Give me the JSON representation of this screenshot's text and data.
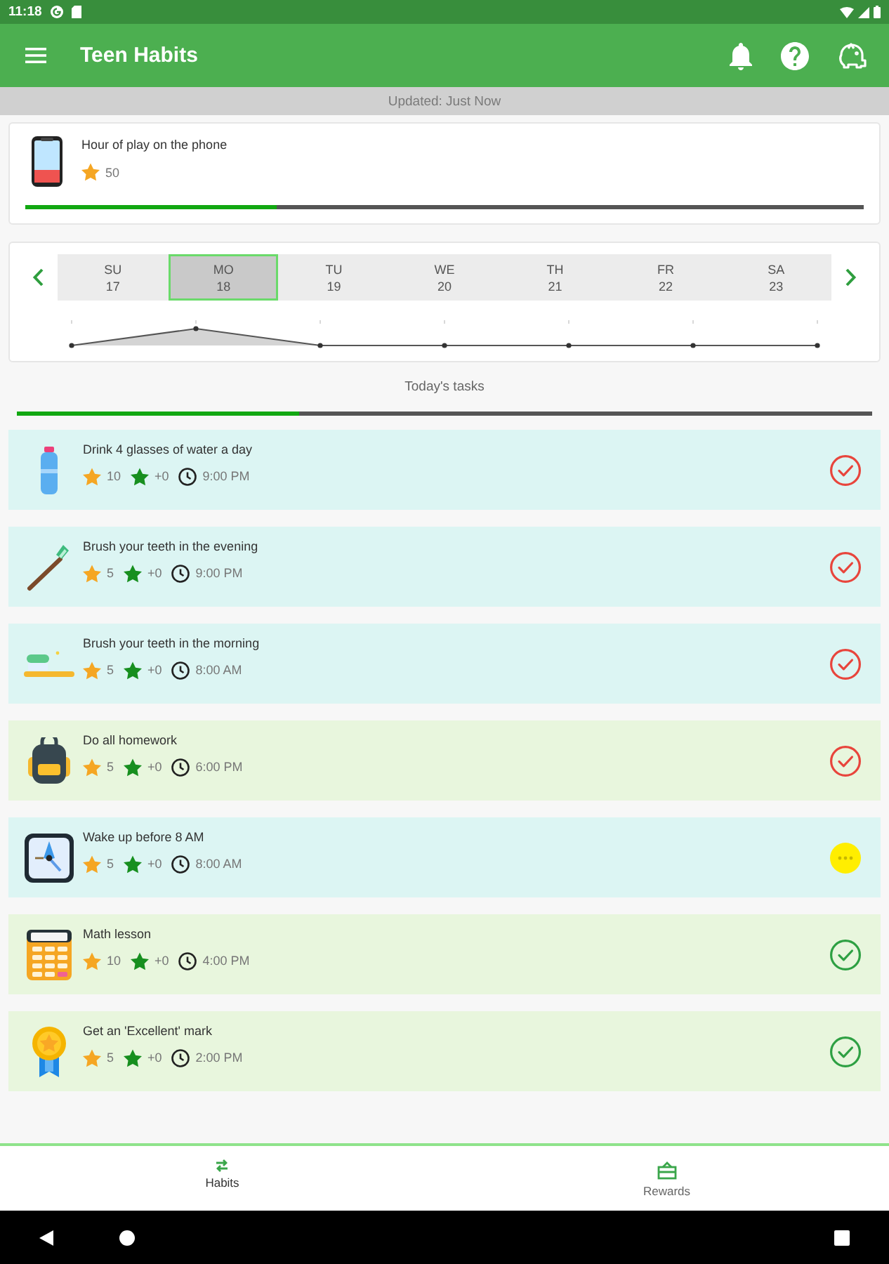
{
  "status_bar": {
    "time": "11:18"
  },
  "app_bar": {
    "title": "Teen Habits"
  },
  "update_banner": {
    "text": "Updated: Just Now"
  },
  "reward": {
    "title": "Hour of play on the phone",
    "points": "50",
    "level": 0.3
  },
  "week": {
    "days": [
      {
        "day": "SU",
        "date": "17",
        "selected": false
      },
      {
        "day": "MO",
        "date": "18",
        "selected": true
      },
      {
        "day": "TU",
        "date": "19",
        "selected": false
      },
      {
        "day": "WE",
        "date": "20",
        "selected": false
      },
      {
        "day": "TH",
        "date": "21",
        "selected": false
      },
      {
        "day": "FR",
        "date": "22",
        "selected": false
      },
      {
        "day": "SA",
        "date": "23",
        "selected": false
      }
    ]
  },
  "tasks_header": {
    "title": "Today's tasks",
    "level": 0.33
  },
  "tasks": [
    {
      "kind": "bottle",
      "title": "Drink 4 glasses of water a day",
      "points": "10",
      "bonus": "+0",
      "time": "9:00 PM",
      "color": "#dcf5f3",
      "status_icon": {
        "kind": "check",
        "color": "#e8453c"
      }
    },
    {
      "kind": "toothbrush",
      "title": "Brush your teeth in the evening",
      "points": "5",
      "bonus": "+0",
      "time": "9:00 PM",
      "color": "#dcf5f3",
      "status_icon": {
        "kind": "check",
        "color": "#e8453c"
      }
    },
    {
      "kind": "toothpaste",
      "title": "Brush your teeth in the morning",
      "points": "5",
      "bonus": "+0",
      "time": "8:00 AM",
      "color": "#dcf5f3",
      "status_icon": {
        "kind": "check",
        "color": "#e8453c"
      }
    },
    {
      "kind": "backpack",
      "title": "Do all homework",
      "points": "5",
      "bonus": "+0",
      "time": "6:00 PM",
      "color": "#e8f6dd",
      "status_icon": {
        "kind": "check",
        "color": "#e8453c"
      }
    },
    {
      "kind": "clock",
      "title": "Wake up before 8 AM",
      "points": "5",
      "bonus": "+0",
      "time": "8:00 AM",
      "color": "#dcf5f3",
      "status_icon": {
        "kind": "dots",
        "color": "#ffee00"
      }
    },
    {
      "kind": "calculator",
      "title": "Math lesson",
      "points": "10",
      "bonus": "+0",
      "time": "4:00 PM",
      "color": "#e8f6dd",
      "status_icon": {
        "kind": "check",
        "color": "#2ea043"
      }
    },
    {
      "kind": "medal",
      "title": "Get an 'Excellent' mark",
      "points": "5",
      "bonus": "+0",
      "time": "2:00 PM",
      "color": "#e8f6dd",
      "status_icon": {
        "kind": "check",
        "color": "#2ea043"
      }
    }
  ],
  "bottom_nav": [
    {
      "label": "Habits",
      "selected": true
    },
    {
      "label": "Rewards",
      "selected": false
    }
  ]
}
